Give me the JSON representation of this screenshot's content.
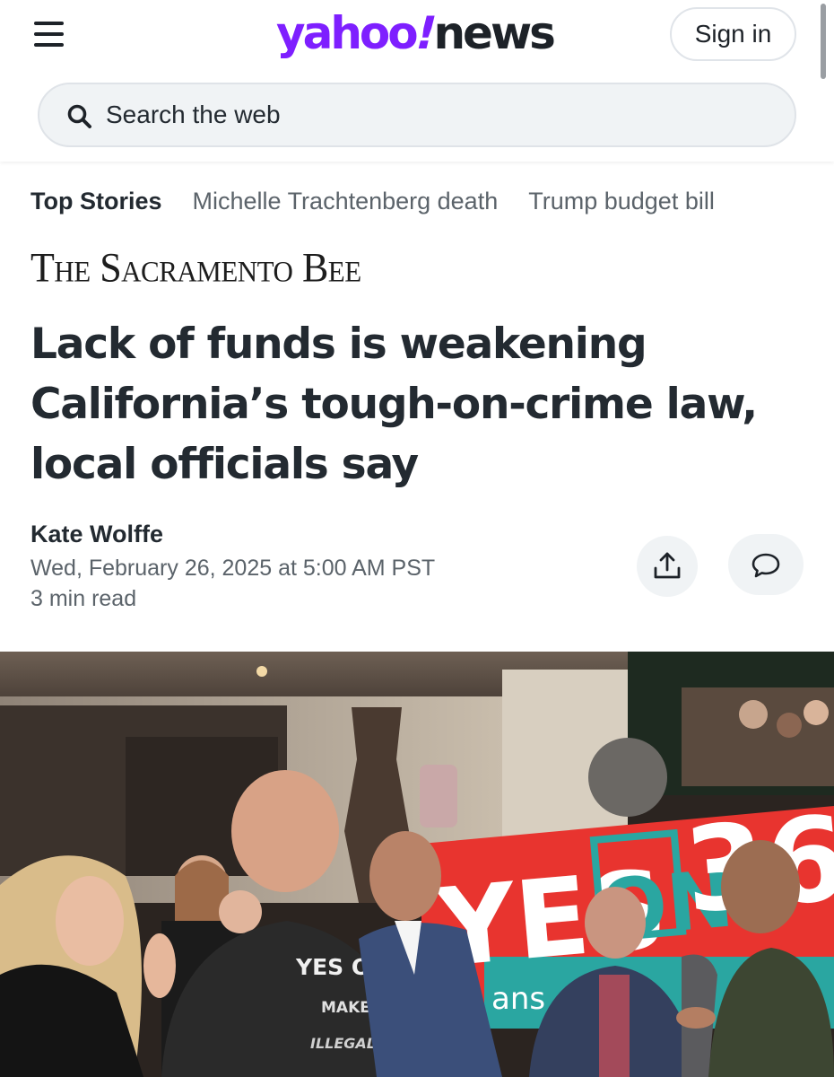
{
  "header": {
    "logo_main": "yahoo",
    "logo_bang": "!",
    "logo_section": "news",
    "signin_label": "Sign in",
    "brand_color": "#7e1fff"
  },
  "search": {
    "placeholder": "Search the web",
    "icon": "search-icon"
  },
  "tabs": [
    {
      "label": "Top Stories",
      "active": true
    },
    {
      "label": "Michelle Trachtenberg death",
      "active": false
    },
    {
      "label": "Trump budget bill",
      "active": false
    }
  ],
  "article": {
    "publisher": "The Sacramento Bee",
    "headline": "Lack of funds is weakening California’s tough-on-crime law, local officials say",
    "author": "Kate Wolffe",
    "date": "Wed, February 26, 2025 at 5:00 AM PST",
    "read_time": "3 min read",
    "actions": [
      {
        "name": "share",
        "icon": "share-icon"
      },
      {
        "name": "comments",
        "icon": "comment-icon"
      }
    ]
  },
  "hero_image": {
    "banner_text_1": "YES",
    "banner_text_2": "ON",
    "banner_text_3": "36",
    "banner_side_text": "ans",
    "shirt_line_1": "YES ON 36",
    "shirt_line_2": "MAKE CRIME",
    "shirt_line_3": "ILLEGAL AGAIN",
    "banner_color": "#e8342f",
    "banner_accent": "#2aa6a1"
  }
}
